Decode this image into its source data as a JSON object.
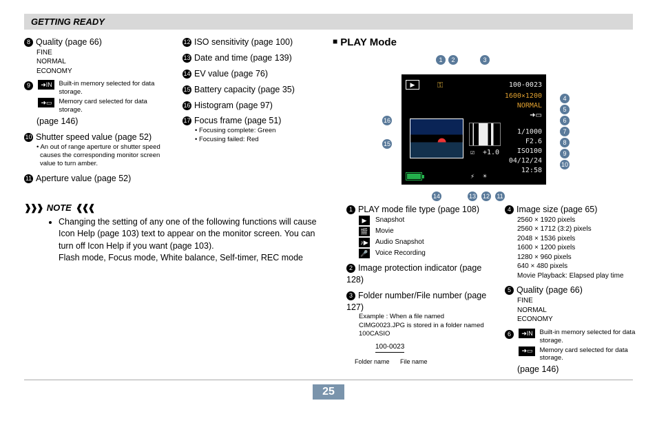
{
  "header": "GETTING READY",
  "page_number": "25",
  "left": {
    "col1": {
      "items": [
        {
          "n": "8",
          "label": "Quality (page 66)",
          "subs": [
            "FINE",
            "NORMAL",
            "ECONOMY"
          ]
        },
        {
          "n": "9",
          "label": "",
          "icons": [
            {
              "name": "internal-memory-icon",
              "text": "Built-in memory selected for data storage."
            },
            {
              "name": "memory-card-icon",
              "text": "Memory card selected for data storage."
            }
          ],
          "after": "(page 146)"
        },
        {
          "n": "10",
          "label": "Shutter speed value (page 52)",
          "note": "An out of range aperture or shutter speed causes the corresponding monitor screen value to turn amber."
        },
        {
          "n": "11",
          "label": "Aperture value (page 52)"
        }
      ]
    },
    "col2": {
      "items": [
        {
          "n": "12",
          "label": "ISO sensitivity (page 100)"
        },
        {
          "n": "13",
          "label": "Date and time (page 139)"
        },
        {
          "n": "14",
          "label": "EV value (page 76)"
        },
        {
          "n": "15",
          "label": "Battery capacity (page 35)"
        },
        {
          "n": "16",
          "label": "Histogram (page 97)"
        },
        {
          "n": "17",
          "label": "Focus frame      (page 51)",
          "bullets": [
            "Focusing complete: Green",
            "Focusing failed: Red"
          ]
        }
      ]
    },
    "note": {
      "heading": "NOTE",
      "body": "Changing the setting of any one of the following functions will cause Icon Help (page 103) text to appear on the monitor screen. You can turn off Icon Help if you want (page 103).",
      "body2": "Flash mode, Focus mode, White balance, Self-timer, REC mode"
    }
  },
  "right": {
    "title": "PLAY Mode",
    "lcd": {
      "folder_file": "100-0023",
      "resolution": "1600×1200",
      "quality": "NORMAL",
      "ev": "+1.0",
      "shutter": "1/1000",
      "aperture": "F2.6",
      "iso": "ISO100",
      "date": "04/12/24",
      "time": "12:58"
    },
    "callouts_top": [
      "1",
      "2",
      "3"
    ],
    "callouts_right": [
      "4",
      "5",
      "6",
      "7",
      "8",
      "9",
      "10"
    ],
    "callouts_left": [
      "16",
      "15"
    ],
    "callouts_bottom": [
      "14",
      "13",
      "12",
      "11"
    ],
    "col3": {
      "items": [
        {
          "n": "1",
          "label": "PLAY mode file type (page 108)",
          "icons": [
            {
              "name": "snapshot-icon",
              "text": "Snapshot"
            },
            {
              "name": "movie-icon",
              "text": "Movie"
            },
            {
              "name": "audio-snapshot-icon",
              "text": "Audio Snapshot"
            },
            {
              "name": "voice-recording-icon",
              "text": "Voice Recording"
            }
          ]
        },
        {
          "n": "2",
          "label": "Image protection indicator (page 128)"
        },
        {
          "n": "3",
          "label": "Folder number/File number (page 127)",
          "sub_note": "Example : When a file named CIMG0023.JPG is stored in a folder named 100CASIO",
          "folder_diagram": {
            "num": "100-0023",
            "l": "Folder name",
            "r": "File name"
          }
        }
      ]
    },
    "col4": {
      "items": [
        {
          "n": "4",
          "label": "Image size (page 65)",
          "subs": [
            "2560 × 1920 pixels",
            "2560 × 1712 (3:2) pixels",
            "2048 × 1536 pixels",
            "1600 × 1200 pixels",
            "1280 ×   960 pixels",
            "  640 ×   480 pixels",
            "Movie Playback: Elapsed play time"
          ]
        },
        {
          "n": "5",
          "label": "Quality (page 66)",
          "subs": [
            "FINE",
            "NORMAL",
            "ECONOMY"
          ]
        },
        {
          "n": "6",
          "label": "",
          "icons": [
            {
              "name": "internal-memory-icon",
              "text": "Built-in memory selected for data storage."
            },
            {
              "name": "memory-card-icon",
              "text": "Memory card selected for data storage."
            }
          ],
          "after": "(page 146)"
        }
      ]
    }
  }
}
